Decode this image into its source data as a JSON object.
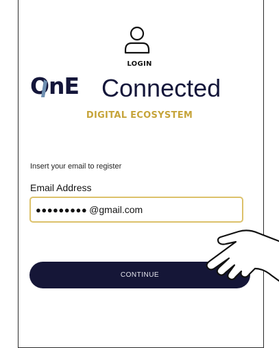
{
  "header": {
    "icon": "user-icon",
    "title": "LOGIN"
  },
  "logo": {
    "one": "OnE",
    "connected": "Connected",
    "subtitle": "DIGITAL ECOSYSTEM",
    "colors": {
      "navy": "#14163a",
      "gold": "#c6a43a",
      "accent_blue": "#6f8fb0"
    }
  },
  "form": {
    "prompt": "Insert your email to register",
    "email_label": "Email Address",
    "email_masked": "●●●●●●●●●",
    "email_domain": "@gmail.com",
    "field_border_color": "#dcc16a"
  },
  "actions": {
    "continue_label": "CONTINUE",
    "button_color": "#151637"
  },
  "overlay": {
    "icon": "pointing-hand-icon"
  }
}
